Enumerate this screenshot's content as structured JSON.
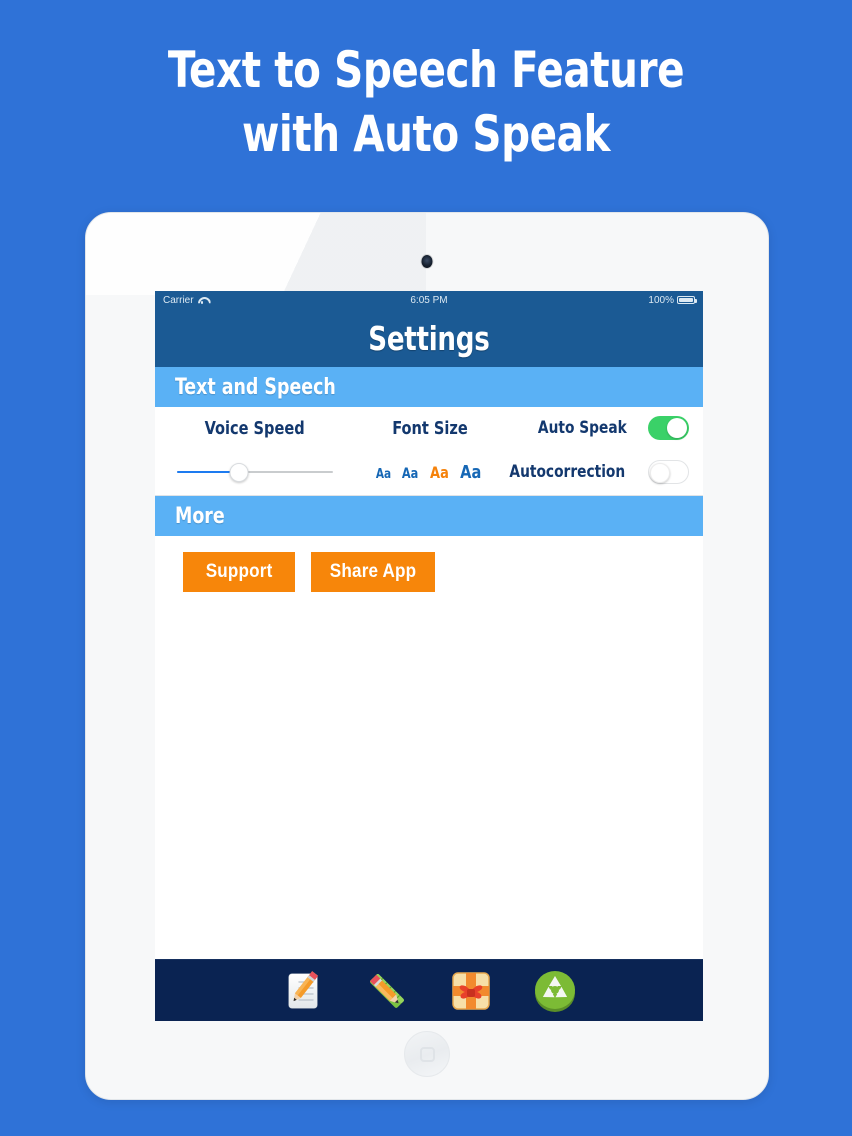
{
  "promo": {
    "headline_line1": "Text to Speech Feature",
    "headline_line2": "with Auto Speak",
    "background_color": "#2f72d7",
    "text_color": "#ffffff"
  },
  "device": {
    "type": "tablet-frame",
    "bezel_color": "#f7f8f9",
    "camera": "camera-dot",
    "home_button": "home-button"
  },
  "status_bar": {
    "carrier": "Carrier",
    "wifi_icon": "wifi-icon",
    "time": "6:05 PM",
    "battery_percent": "100%",
    "battery_icon": "battery-full-icon",
    "background_color": "#1b5a94"
  },
  "navbar": {
    "title": "Settings",
    "background_color": "#1b5a94",
    "title_color": "#ffffff"
  },
  "sections": [
    {
      "header": "Text and Speech",
      "header_color": "#5ab1f5"
    },
    {
      "header": "More",
      "header_color": "#5ab1f5"
    }
  ],
  "text_and_speech": {
    "voice_speed_label": "Voice Speed",
    "font_size_label": "Font Size",
    "auto_speak_label": "Auto Speak",
    "autocorrection_label": "Autocorrection",
    "slider": {
      "value_percent": 40,
      "fill_color": "#1d7bf0",
      "track_color": "#c9ccce"
    },
    "font_sizes": [
      {
        "label": "Aa",
        "selected": false
      },
      {
        "label": "Aa",
        "selected": false
      },
      {
        "label": "Aa",
        "selected": true
      },
      {
        "label": "Aa",
        "selected": false
      }
    ],
    "selected_font_color": "#f5820b",
    "font_option_color": "#1667b5",
    "auto_speak_on": true,
    "autocorrection_on": false,
    "toggle_on_color": "#3ad168",
    "label_color": "#13386e"
  },
  "more": {
    "support_button": "Support",
    "share_button": "Share App",
    "button_color": "#f7860a",
    "button_text_color": "#ffffff"
  },
  "tabbar": {
    "background_color": "#0a2352",
    "items": [
      {
        "icon": "note-pencil-icon"
      },
      {
        "icon": "pencil-ruler-icon"
      },
      {
        "icon": "gift-box-icon"
      },
      {
        "icon": "recycle-icon"
      }
    ]
  }
}
